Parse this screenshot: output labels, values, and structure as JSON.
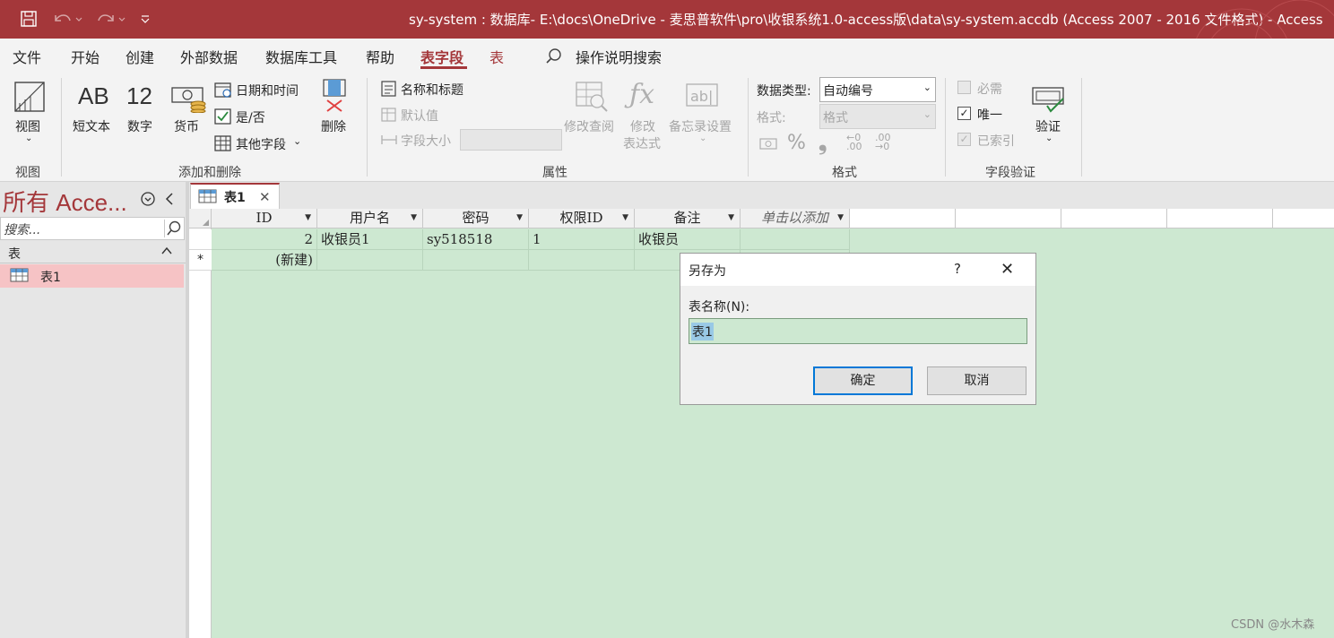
{
  "title_bar": {
    "title": "sy-system : 数据库- E:\\docs\\OneDrive - 麦思普软件\\pro\\收银系统1.0-access版\\data\\sy-system.accdb (Access 2007 - 2016 文件格式)  -  Access",
    "bg_color": "#a4373a",
    "icons": [
      "save-icon",
      "undo-icon",
      "redo-icon",
      "customize-quick-access-icon"
    ]
  },
  "ribbon_tabs": [
    "文件",
    "开始",
    "创建",
    "外部数据",
    "数据库工具",
    "帮助",
    "表字段",
    "表"
  ],
  "active_tab": "表字段",
  "tell_me": "操作说明搜索",
  "ribbon": {
    "view": {
      "label": "视图",
      "group": "视图"
    },
    "add_delete": {
      "short_text_glyph": "AB",
      "short_text": "短文本",
      "number_glyph": "12",
      "number": "数字",
      "currency": "货币",
      "date_time": "日期和时间",
      "yes_no": "是/否",
      "more_fields": "其他字段",
      "delete": "删除",
      "group": "添加和删除"
    },
    "properties": {
      "name_caption": "名称和标题",
      "default_value": "默认值",
      "field_size": "字段大小",
      "modify_lookups": "修改查阅",
      "modify_expression_1": "修改",
      "modify_expression_2": "表达式",
      "memo_settings": "备忘录设置",
      "group": "属性"
    },
    "formatting": {
      "data_type_label": "数据类型:",
      "data_type_value": "自动编号",
      "format_label": "格式:",
      "format_value": "格式",
      "group": "格式"
    },
    "validation": {
      "required": "必需",
      "unique": "唯一",
      "indexed": "已索引",
      "validation": "验证",
      "group": "字段验证"
    }
  },
  "nav_pane": {
    "title": "所有 Acce...",
    "search_placeholder": "搜索...",
    "section": "表",
    "items": [
      "表1"
    ],
    "selected_color": "#f6c3c5"
  },
  "document_tab": "表1",
  "table": {
    "columns": [
      "ID",
      "用户名",
      "密码",
      "权限ID",
      "备注",
      "单击以添加"
    ],
    "rows": [
      {
        "ID": "2",
        "用户名": "收银员1",
        "密码": "sy518518",
        "权限ID": "1",
        "备注": "收银员"
      }
    ],
    "new_row_marker": "*",
    "new_row_label": "(新建)",
    "grid_color": "#cde8d1"
  },
  "dialog": {
    "title": "另存为",
    "help": "?",
    "label": "表名称(N):",
    "value": "表1",
    "ok": "确定",
    "cancel": "取消"
  },
  "watermark": "CSDN @水木森"
}
